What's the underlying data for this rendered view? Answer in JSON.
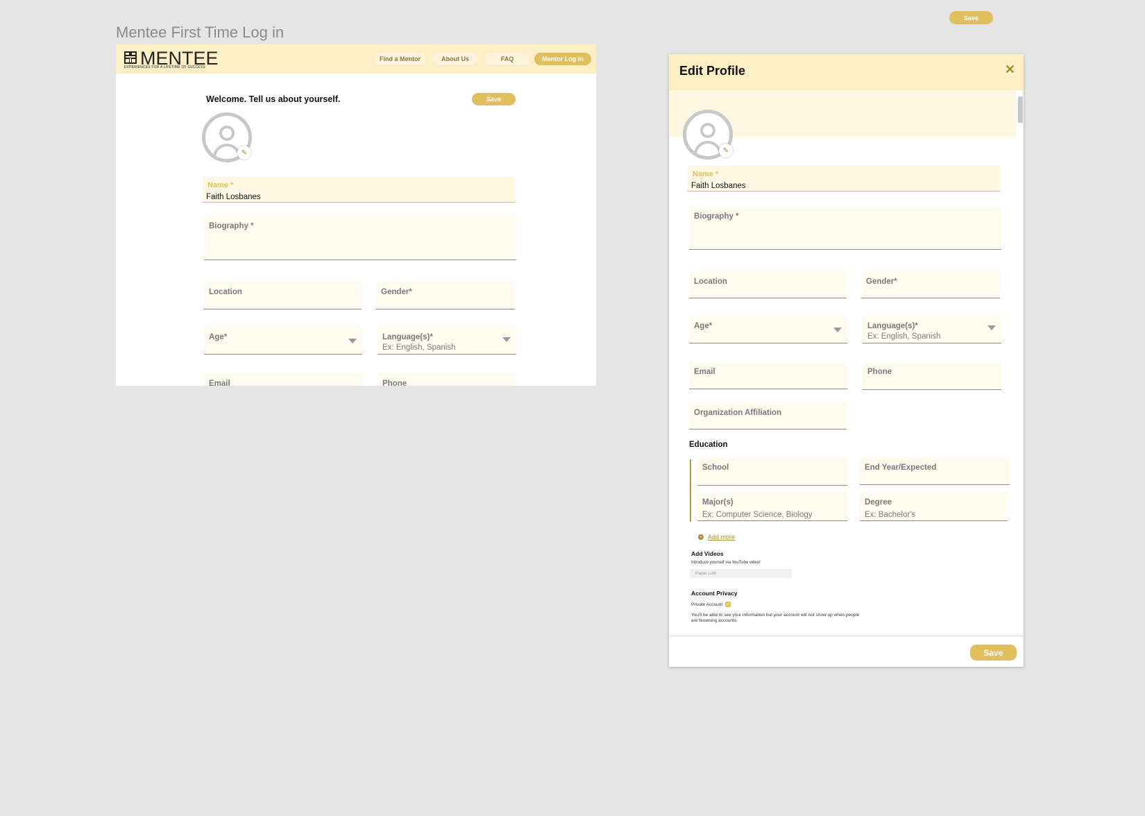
{
  "canvas": {
    "title": "Mentee First Time Log in",
    "floating_save_label": "Save"
  },
  "first_login": {
    "logo": {
      "word": "MENTEE",
      "tagline": "EXPERIENCES FOR A LIFETIME OF SUCCESS"
    },
    "nav": [
      {
        "label": "Find a Mentor"
      },
      {
        "label": "About Us"
      },
      {
        "label": "FAQ"
      },
      {
        "label": "Mentor Log in"
      }
    ],
    "welcome": "Welcome. Tell us about yourself.",
    "save_label": "Save",
    "fields": {
      "name_label": "Name *",
      "name_value": "Faith Losbanes",
      "biography_label": "Biography *",
      "location_label": "Location",
      "gender_label": "Gender*",
      "age_label": "Age*",
      "languages_label": "Language(s)*",
      "languages_placeholder": "Ex: English, Spanish",
      "email_label": "Email",
      "phone_label": "Phone"
    }
  },
  "edit_profile": {
    "title": "Edit Profile",
    "close_icon": "close-icon",
    "fields": {
      "name_label": "Name *",
      "name_value": "Faith Losbanes",
      "biography_label": "Biography *",
      "location_label": "Location",
      "gender_label": "Gender*",
      "age_label": "Age*",
      "languages_label": "Language(s)*",
      "languages_placeholder": "Ex: English, Spanish",
      "email_label": "Email",
      "phone_label": "Phone",
      "org_label": "Organization Affiliation"
    },
    "education": {
      "heading": "Education",
      "school_label": "School",
      "end_year_label": "End Year/Expected",
      "major_label": "Major(s)",
      "major_placeholder": "Ex: Computer Science, Biology",
      "degree_label": "Degree",
      "degree_placeholder": "Ex: Bachelor's",
      "add_more": "Add more"
    },
    "videos": {
      "heading": "Add Videos",
      "hint": "Introduce yourself via YouTube video!",
      "paste_placeholder": "Paste Link"
    },
    "privacy": {
      "heading": "Account Privacy",
      "checkbox_label": "Private Account",
      "checked": true,
      "note": "You'll be able to see your information but your account will not show up when people are browsing accounts."
    },
    "save_label": "Save"
  },
  "colors": {
    "accent": "#e0bf5e",
    "header_bg": "#fcefc6",
    "field_bg": "#fffbef",
    "canvas_bg": "#e5e5e5"
  }
}
